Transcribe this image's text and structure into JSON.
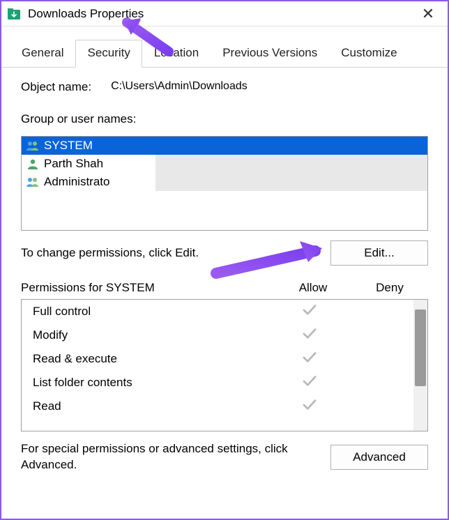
{
  "window": {
    "title": "Downloads Properties"
  },
  "tabs": [
    {
      "label": "General",
      "active": false
    },
    {
      "label": "Security",
      "active": true
    },
    {
      "label": "Location",
      "active": false
    },
    {
      "label": "Previous Versions",
      "active": false
    },
    {
      "label": "Customize",
      "active": false
    }
  ],
  "object": {
    "label": "Object name:",
    "path": "C:\\Users\\Admin\\Downloads"
  },
  "group_label": "Group or user names:",
  "users": [
    {
      "name": "SYSTEM",
      "icon": "users-icon",
      "selected": true
    },
    {
      "name": "Parth Shah",
      "icon": "user-icon",
      "selected": false,
      "truncated": true
    },
    {
      "name": "Administrators",
      "display": "Administrato",
      "icon": "users-icon",
      "selected": false,
      "truncated": true
    }
  ],
  "edit_hint": "To change permissions, click Edit.",
  "edit_button": "Edit...",
  "permissions_for_label": "Permissions for SYSTEM",
  "columns": {
    "allow": "Allow",
    "deny": "Deny"
  },
  "permissions": [
    {
      "name": "Full control",
      "allow": true,
      "deny": false
    },
    {
      "name": "Modify",
      "allow": true,
      "deny": false
    },
    {
      "name": "Read & execute",
      "allow": true,
      "deny": false
    },
    {
      "name": "List folder contents",
      "allow": true,
      "deny": false
    },
    {
      "name": "Read",
      "allow": true,
      "deny": false
    }
  ],
  "advanced_hint": "For special permissions or advanced settings, click Advanced.",
  "advanced_button": "Advanced"
}
